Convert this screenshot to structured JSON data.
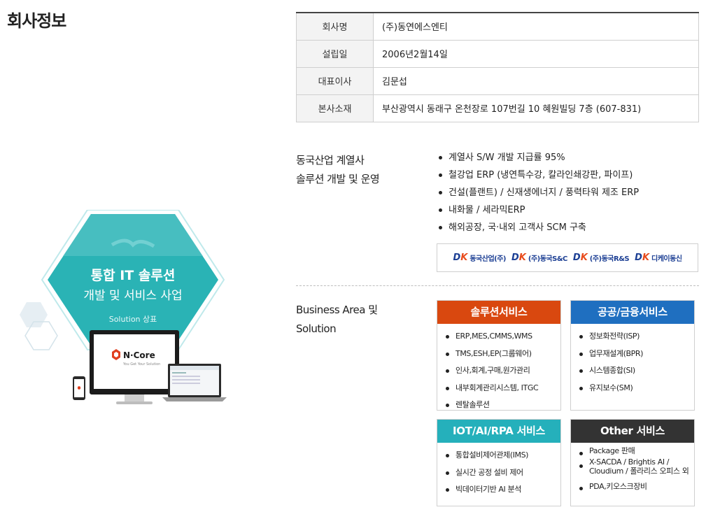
{
  "page_title": "회사정보",
  "company_info": [
    {
      "key": "회사명",
      "value": "(주)동연에스엔티"
    },
    {
      "key": "설립일",
      "value": "2006년2월14일"
    },
    {
      "key": "대표이사",
      "value": "김문섭"
    },
    {
      "key": "본사소재",
      "value": "부산광역시 동래구 온천장로 107번길 10 혜원빌딩 7층 (607-831)"
    }
  ],
  "graphic": {
    "headline_line1": "통합 IT 솔루션",
    "headline_line2": "개발 및 서비스 사업",
    "tag": "Solution 상표",
    "product_logo": "N·Core",
    "product_tagline": "You Get Your Solution",
    "colors": {
      "hex": "#2ab3b5",
      "ring": "#8fdcde"
    }
  },
  "group_section": {
    "label_line1": "동국산업 계열사",
    "label_line2": "솔루션 개발 및 운영",
    "bullets": [
      "계열사 S/W 개발 지급률 95%",
      "철강업 ERP (냉연특수강, 칼라인쇄강판, 파이프)",
      "건설(플랜트) / 신재생에너지 / 풍력타워 제조 ERP",
      "내화물 / 세라믹ERP",
      "해외공장, 국·내외 고객사 SCM 구축"
    ],
    "logos": [
      {
        "mark_d": "D",
        "mark_k": "K",
        "name": "동국산업(주)"
      },
      {
        "mark_d": "D",
        "mark_k": "K",
        "name": "(주)동국S&C"
      },
      {
        "mark_d": "D",
        "mark_k": "K",
        "name": "(주)동국R&S"
      },
      {
        "mark_d": "D",
        "mark_k": "K",
        "name": "디케이동신"
      }
    ]
  },
  "business_section": {
    "label_line1": "Business Area 및",
    "label_line2": "Solution",
    "boxes": [
      {
        "title": "솔루션서비스",
        "color": "#d9480f",
        "items": [
          "ERP,MES,CMMS,WMS",
          "TMS,ESH,EP(그룹웨어)",
          "인사,회계,구매,원가관리",
          "내부회계관리시스템, ITGC",
          "렌탈솔루션"
        ]
      },
      {
        "title": "공공/금융서비스",
        "color": "#1f6fc0",
        "items": [
          "정보화전략(ISP)",
          "업무재설계(BPR)",
          "시스템종합(SI)",
          "유지보수(SM)"
        ]
      },
      {
        "title": "IOT/AI/RPA 서비스",
        "color": "#25b0bb",
        "items": [
          "통합설비제어관제(IMS)",
          "실시간 공정 설비 제어",
          "빅데이터기반 AI 분석"
        ]
      },
      {
        "title": "Other 서비스",
        "color": "#333333",
        "items": [
          "Package 판매",
          "X-SACDA / Brightis AI / Cloudium / 폴라리스 오피스 외",
          "PDA,키오스크장비"
        ]
      }
    ]
  }
}
